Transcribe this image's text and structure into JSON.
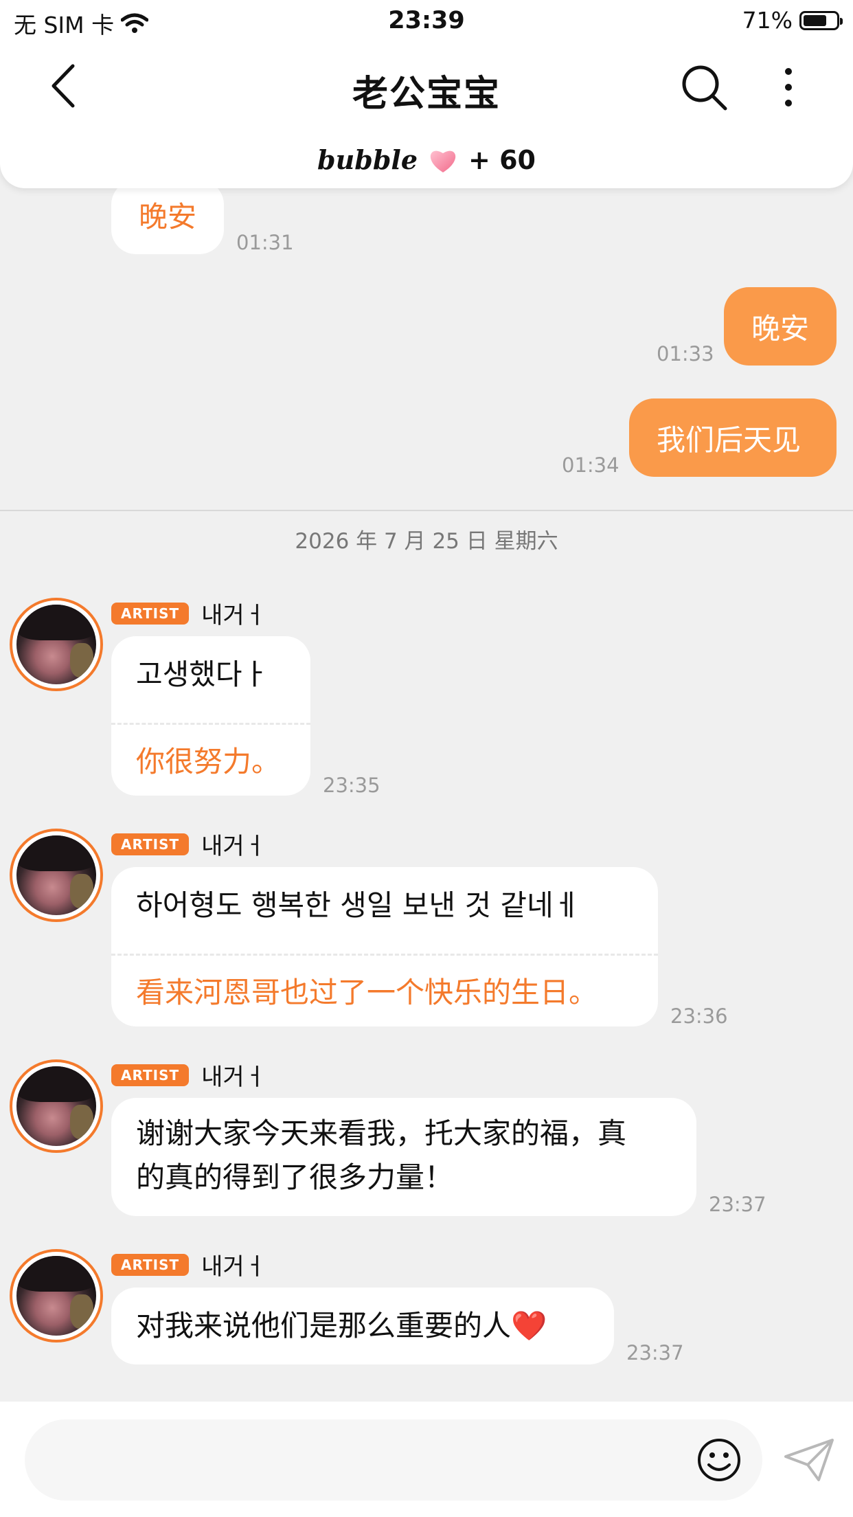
{
  "status_bar": {
    "carrier": "无 SIM 卡",
    "time": "23:39",
    "battery": "71%",
    "battery_level": 0.71
  },
  "header": {
    "title": "老公宝宝",
    "bubble_brand": "bubble",
    "bubble_count": "+ 60"
  },
  "messages_before": [
    {
      "text": "晚安",
      "time": "01:31"
    },
    {
      "text": "晚安",
      "time": "01:33"
    },
    {
      "text": "我们后天见",
      "time": "01:34"
    }
  ],
  "date_separator": "2026 年 7 月 25 日  星期六",
  "artist_messages": [
    {
      "badge": "ARTIST",
      "name": "내거ㅓ",
      "ko": "고생했다ㅏ",
      "zh": "你很努力。",
      "time": "23:35"
    },
    {
      "badge": "ARTIST",
      "name": "내거ㅓ",
      "ko": "하어형도 행복한 생일 보낸 것 같네ㅔ",
      "zh": "看来河恩哥也过了一个快乐的生日。",
      "time": "23:36"
    },
    {
      "badge": "ARTIST",
      "name": "내거ㅓ",
      "text_line1": "谢谢大家今天来看我，托大家的福，真",
      "text_line2": "的真的得到了很多力量！",
      "time": "23:37"
    },
    {
      "badge": "ARTIST",
      "name": "내거ㅓ",
      "text": "对我来说他们是那么重要的人",
      "emoji": "❤️",
      "time": "23:37"
    }
  ],
  "input": {
    "placeholder": ""
  },
  "colors": {
    "accent": "#f47a2c",
    "outgoing_bubble": "#fa9a4a",
    "background": "#f0f0f0"
  }
}
